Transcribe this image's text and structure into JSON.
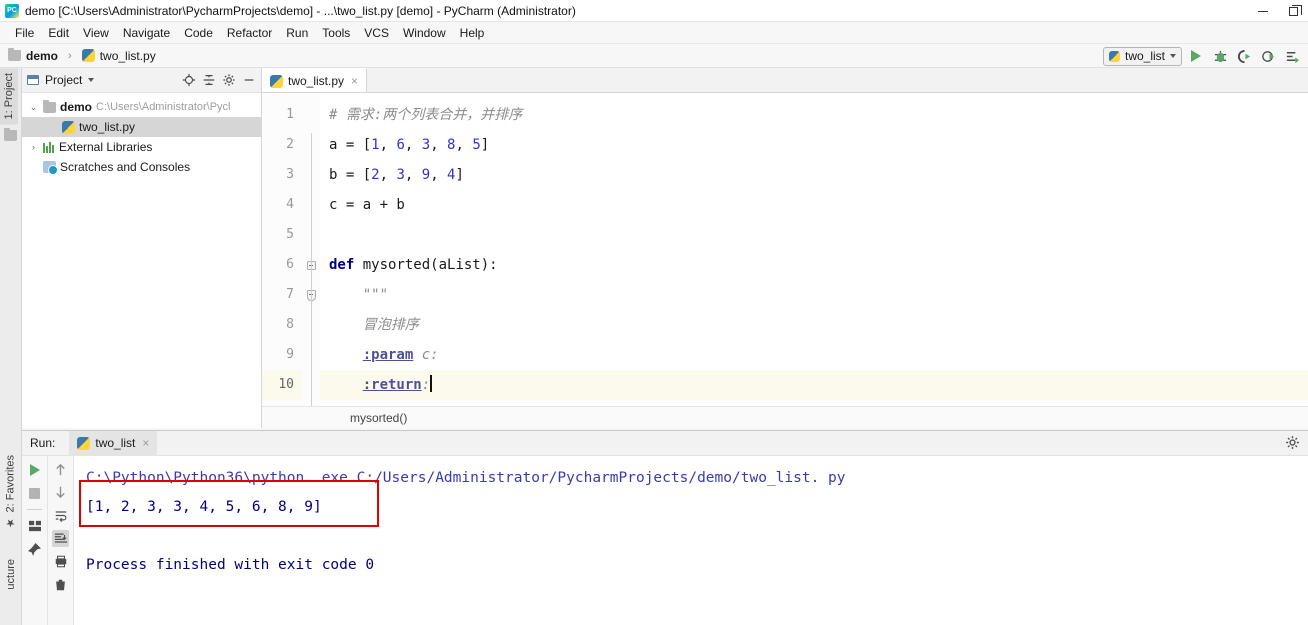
{
  "window": {
    "title": "demo [C:\\Users\\Administrator\\PycharmProjects\\demo] - ...\\two_list.py [demo] - PyCharm (Administrator)",
    "logo_label": "PC",
    "minimize": "—",
    "restore": "❐"
  },
  "menu": {
    "items": [
      "File",
      "Edit",
      "View",
      "Navigate",
      "Code",
      "Refactor",
      "Run",
      "Tools",
      "VCS",
      "Window",
      "Help"
    ]
  },
  "navbar": {
    "project": "demo",
    "separator": "›",
    "file": "two_list.py",
    "run_config": "two_list",
    "icons": [
      "run-icon",
      "debug-icon",
      "coverage-icon",
      "profile-icon",
      "run-with-params-icon"
    ]
  },
  "project_panel": {
    "title": "Project",
    "toolbar_icons": [
      "locate-icon",
      "collapse-all-icon",
      "settings-icon",
      "hide-icon"
    ],
    "tree": [
      {
        "label": "demo",
        "path": "C:\\Users\\Administrator\\Pycl",
        "arrow": "⌄",
        "icon": "folder-icon",
        "bold": true,
        "selected": false,
        "indent": 0
      },
      {
        "label": "two_list.py",
        "path": "",
        "arrow": "",
        "icon": "python-file-icon",
        "bold": false,
        "selected": true,
        "indent": 1
      },
      {
        "label": "External Libraries",
        "path": "",
        "arrow": "›",
        "icon": "library-icon",
        "bold": false,
        "selected": false,
        "indent": 0
      },
      {
        "label": "Scratches and Consoles",
        "path": "",
        "arrow": "",
        "icon": "scratch-icon",
        "bold": false,
        "selected": false,
        "indent": 0
      }
    ]
  },
  "editor": {
    "tab": {
      "label": "two_list.py",
      "close": "×"
    },
    "breadcrumb": "mysorted()",
    "lines": [
      {
        "no": "1",
        "current": false
      },
      {
        "no": "2",
        "current": false
      },
      {
        "no": "3",
        "current": false
      },
      {
        "no": "4",
        "current": false
      },
      {
        "no": "5",
        "current": false
      },
      {
        "no": "6",
        "current": false
      },
      {
        "no": "7",
        "current": false
      },
      {
        "no": "8",
        "current": false
      },
      {
        "no": "9",
        "current": false
      },
      {
        "no": "10",
        "current": true
      }
    ],
    "code": {
      "l1_comment": "# 需求:两个列表合并，并排序",
      "l2_var": "a = [",
      "l2_n1": "1",
      "l2_n2": "6",
      "l2_n3": "3",
      "l2_n4": "8",
      "l2_n5": "5",
      "l3_var": "b = [",
      "l3_n1": "2",
      "l3_n2": "3",
      "l3_n3": "9",
      "l3_n4": "4",
      "l4": "c = a + b",
      "l5": "",
      "l6_kw": "def",
      "l6_rest": " mysorted(aList):",
      "l7": "    \"\"\"",
      "l8": "    冒泡排序",
      "l9_tag": ":param",
      "l9_rest": " c:",
      "l10_tag": ":return",
      "l10_rest": ":",
      "l11": "    \"\"\"",
      "comma": ", ",
      "bracket_close": "]"
    }
  },
  "run_window": {
    "label": "Run:",
    "tab": "two_list",
    "tab_close": "×",
    "gear": "⚙",
    "toolbar_icons": [
      "rerun-icon",
      "stop-icon",
      "view-layout-icon",
      "pin-icon"
    ],
    "toolbar2_icons": [
      "up-arrow-icon",
      "down-arrow-icon",
      "soft-wrap-icon",
      "scroll-to-end-icon",
      "print-icon",
      "clear-all-icon"
    ],
    "console": {
      "command": "C:\\Python\\Python36\\python. exe C:/Users/Administrator/PycharmProjects/demo/two_list. py",
      "output": "[1, 2, 3, 3, 4, 5, 6, 8, 9]",
      "blank": "",
      "status": "Process finished with exit code 0",
      "highlight_color": "#e00000"
    }
  },
  "sidebar_left": {
    "project_tab": "1: Project",
    "favorites_tab": "2: Favorites",
    "structure_tab": "ucture",
    "star": "★"
  }
}
